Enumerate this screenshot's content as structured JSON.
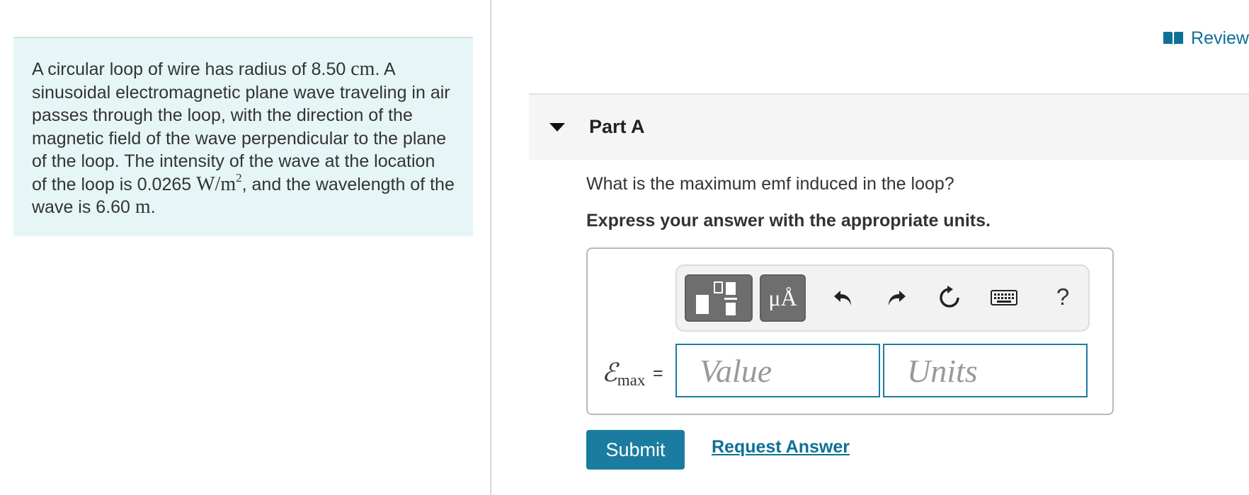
{
  "problem": {
    "text_1": "A circular loop of wire has radius of 8.50 ",
    "unit_cm": "cm",
    "text_2": ". A sinusoidal electromagnetic plane wave traveling in air passes through the loop, with the direction of the magnetic field of the wave perpendicular to the plane of the loop. The intensity of the wave at the location of the loop is 0.0265 ",
    "unit_intensity": "W/m",
    "unit_intensity_exp": "2",
    "text_3": ", and the wavelength of the wave is 6.60 ",
    "unit_m": "m",
    "text_4": "."
  },
  "header": {
    "review_label": "Review"
  },
  "part": {
    "title": "Part A",
    "question": "What is the maximum emf induced in the loop?",
    "instruction": "Express your answer with the appropriate units."
  },
  "toolbar": {
    "units_label": "μÅ",
    "help_label": "?"
  },
  "answer": {
    "symbol": "ℰ",
    "symbol_sub": "max",
    "equals": "=",
    "value_placeholder": "Value",
    "units_placeholder": "Units"
  },
  "actions": {
    "submit_label": "Submit",
    "request_label": "Request Answer"
  },
  "colors": {
    "accent": "#1a7ca0",
    "problem_bg": "#e6f6f6",
    "toolbar_btn": "#6e6e6e"
  }
}
